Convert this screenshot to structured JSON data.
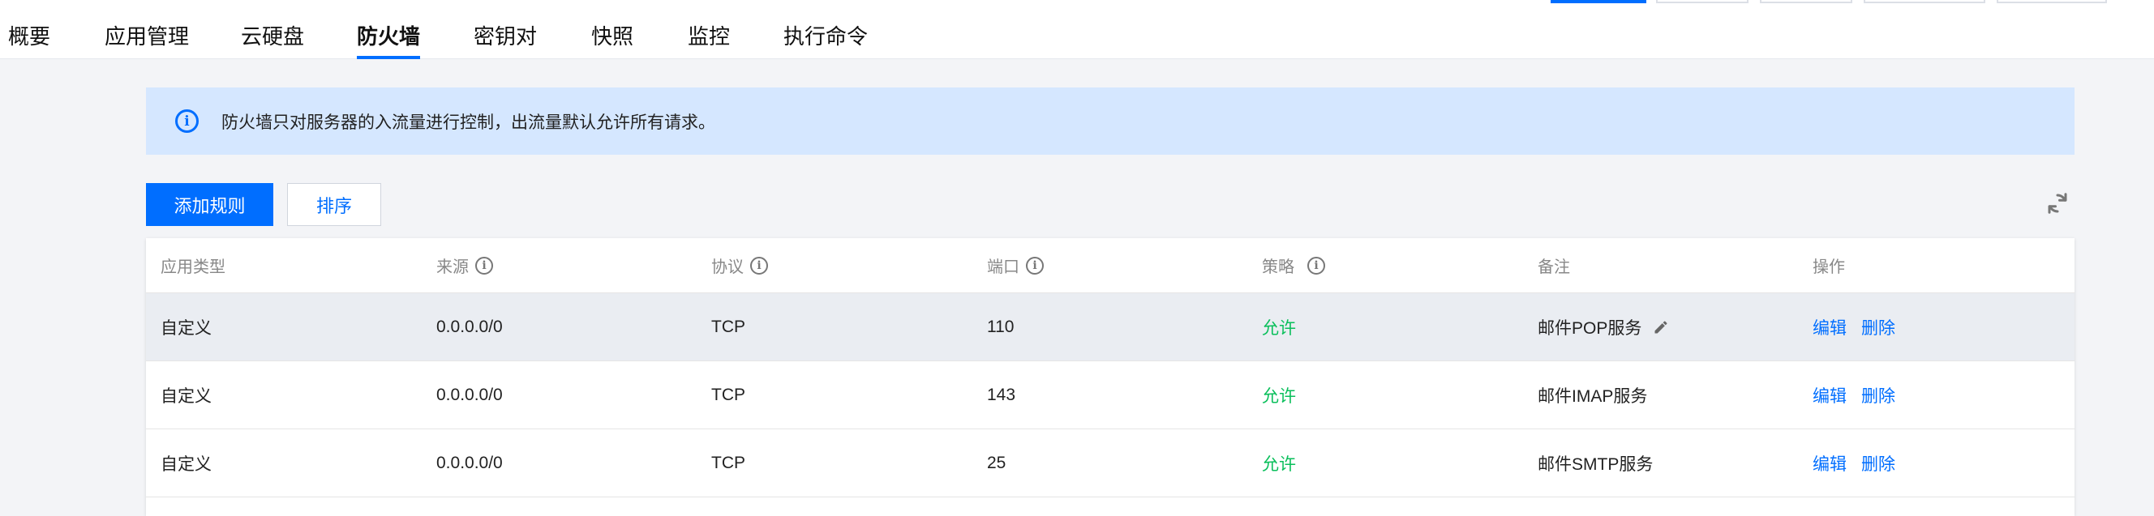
{
  "tabs": [
    {
      "label": "概要"
    },
    {
      "label": "应用管理"
    },
    {
      "label": "云硬盘"
    },
    {
      "label": "防火墙"
    },
    {
      "label": "密钥对"
    },
    {
      "label": "快照"
    },
    {
      "label": "监控"
    },
    {
      "label": "执行命令"
    }
  ],
  "active_tab": "防火墙",
  "notice": {
    "icon": "info-icon",
    "text": "防火墙只对服务器的入流量进行控制，出流量默认允许所有请求。"
  },
  "toolbar": {
    "add_rule": "添加规则",
    "sort": "排序",
    "refresh_icon": "refresh-icon"
  },
  "table": {
    "headers": [
      "应用类型",
      "来源",
      "协议",
      "端口",
      "策略",
      "备注",
      "操作"
    ],
    "rows": [
      {
        "app_type": "自定义",
        "source": "0.0.0.0/0",
        "protocol": "TCP",
        "port": "110",
        "policy": "允许",
        "remark": "邮件POP服务",
        "edit": "编辑",
        "delete": "删除"
      },
      {
        "app_type": "自定义",
        "source": "0.0.0.0/0",
        "protocol": "TCP",
        "port": "143",
        "policy": "允许",
        "remark": "邮件IMAP服务",
        "edit": "编辑",
        "delete": "删除"
      },
      {
        "app_type": "自定义",
        "source": "0.0.0.0/0",
        "protocol": "TCP",
        "port": "25",
        "policy": "允许",
        "remark": "邮件SMTP服务",
        "edit": "编辑",
        "delete": "删除"
      }
    ]
  },
  "colors": {
    "primary": "#006eff",
    "allow": "#0abf5b",
    "notice_bg": "#d5e7ff",
    "page_bg": "#f3f4f7"
  }
}
